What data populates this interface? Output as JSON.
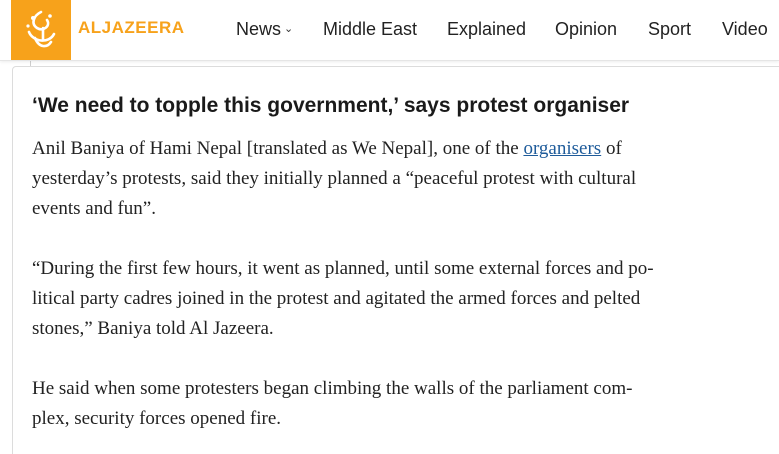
{
  "header": {
    "logo_text": "ALJAZEERA",
    "brand_color": "#f7a21b",
    "nav": [
      {
        "label": "News",
        "has_dropdown": true
      },
      {
        "label": "Middle East"
      },
      {
        "label": "Explained"
      },
      {
        "label": "Opinion"
      },
      {
        "label": "Sport"
      },
      {
        "label": "Video"
      }
    ]
  },
  "post": {
    "headline": "‘We need to topple this government,’ says protest organiser",
    "p1": {
      "before": "Anil Baniya of Hami Nepal [translated as We Nepal], one of the ",
      "link": "organisers",
      "after_line1": " of",
      "line2": "yesterday’s protests, said they initially planned a “peaceful protest with cultural",
      "line3": "events and fun”."
    },
    "p2": {
      "line1": "“During the first few hours, it went as planned, until some external forces and po-",
      "line2": "litical party cadres joined in the protest and agitated the armed forces and pelted",
      "line3": "stones,” Baniya told Al Jazeera."
    },
    "p3": {
      "line1": "He said when some protesters began climbing the walls of the parliament com-",
      "line2": "plex, security forces opened fire."
    }
  }
}
